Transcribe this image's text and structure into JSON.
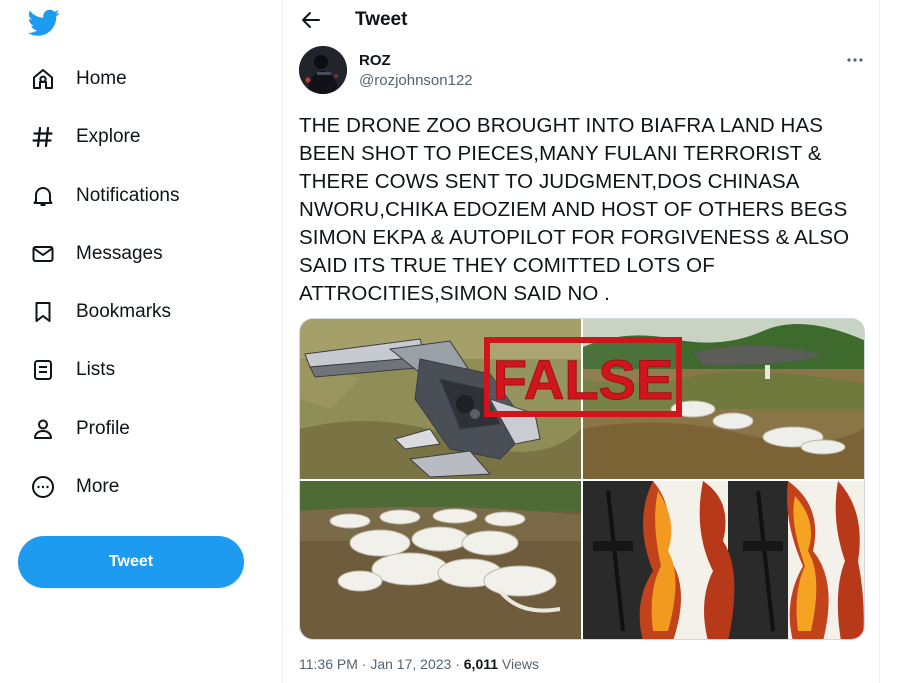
{
  "nav": {
    "items": [
      {
        "label": "Home",
        "icon": "home-icon"
      },
      {
        "label": "Explore",
        "icon": "hashtag-icon"
      },
      {
        "label": "Notifications",
        "icon": "bell-icon"
      },
      {
        "label": "Messages",
        "icon": "envelope-icon"
      },
      {
        "label": "Bookmarks",
        "icon": "bookmark-icon"
      },
      {
        "label": "Lists",
        "icon": "list-icon"
      },
      {
        "label": "Profile",
        "icon": "person-icon"
      },
      {
        "label": "More",
        "icon": "more-circle-icon"
      }
    ],
    "tweet_button": "Tweet"
  },
  "header": {
    "title": "Tweet"
  },
  "tweet": {
    "author_name": "ROZ",
    "author_handle": "@rozjohnson122",
    "text": "THE DRONE ZOO BROUGHT INTO BIAFRA LAND HAS BEEN SHOT TO PIECES,MANY FULANI TERRORIST & THERE COWS SENT TO JUDGMENT,DOS CHINASA NWORU,CHIKA EDOZIEM AND HOST OF OTHERS BEGS SIMON EKPA & AUTOPILOT FOR FORGIVENESS & ALSO SAID ITS TRUE THEY COMITTED LOTS OF ATTROCITIES,SIMON SAID NO .",
    "stamp": "FALSE",
    "time": "11:36 PM",
    "date": "Jan 17, 2023",
    "separator": "·",
    "views_count": "6,011",
    "views_label": "Views"
  },
  "colors": {
    "accent": "#1d9bf0",
    "stamp_red": "#d0151d",
    "muted": "#536471"
  }
}
